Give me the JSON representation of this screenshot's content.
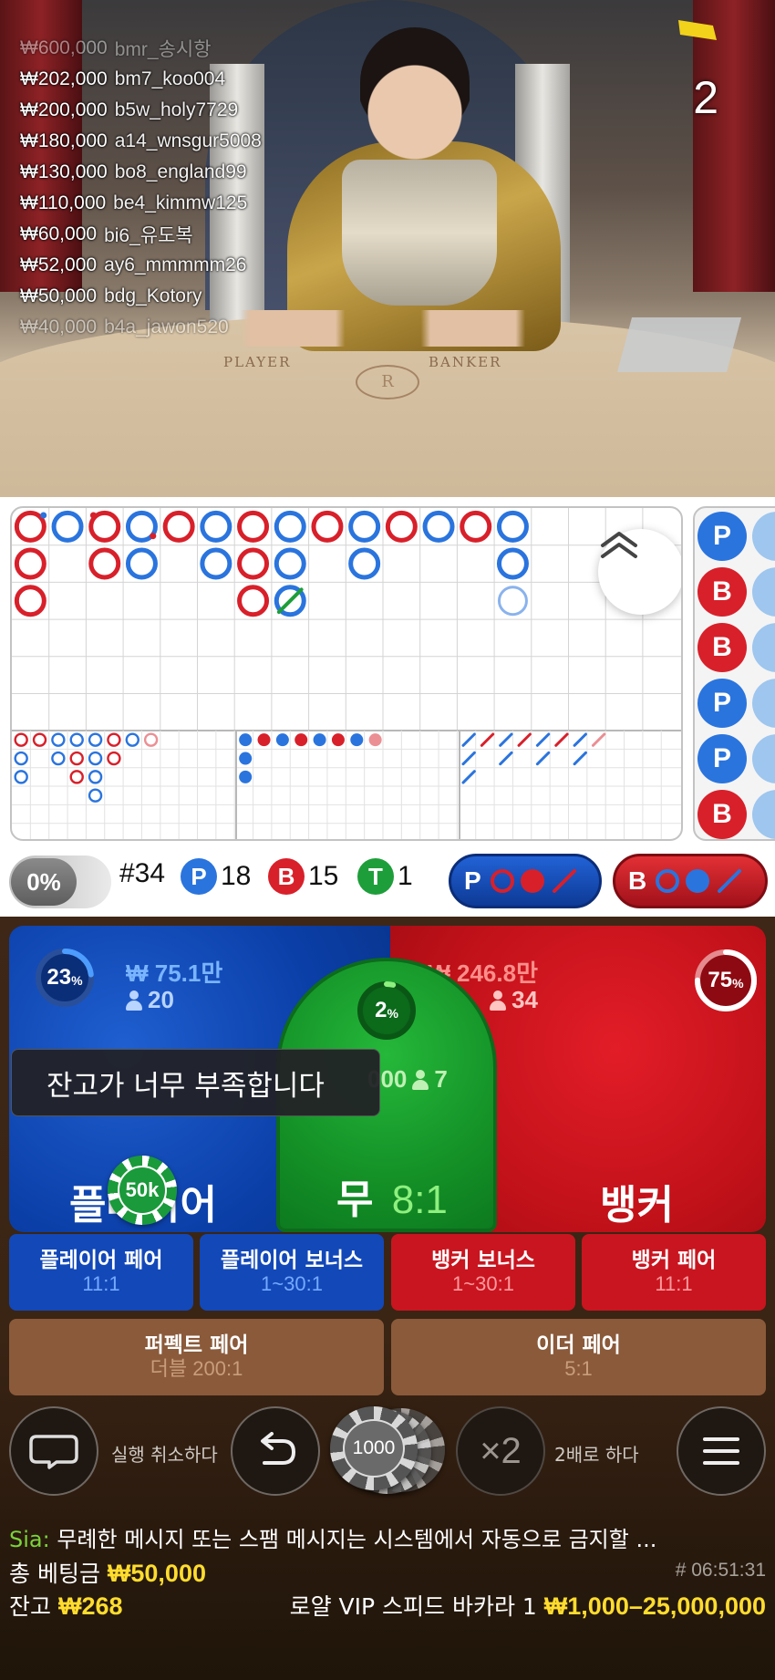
{
  "video": {
    "round_count": "2",
    "felt_player": "PLAYER",
    "felt_banker": "BANKER",
    "felt_logo": "R",
    "winners": [
      {
        "amount": "₩600,000",
        "user": "bmr_송시항",
        "faded": true
      },
      {
        "amount": "₩202,000",
        "user": "bm7_koo004"
      },
      {
        "amount": "₩200,000",
        "user": "b5w_holy7729"
      },
      {
        "amount": "₩180,000",
        "user": "a14_wnsgur5008"
      },
      {
        "amount": "₩130,000",
        "user": "bo8_england99"
      },
      {
        "amount": "₩110,000",
        "user": "be4_kimmw125"
      },
      {
        "amount": "₩60,000",
        "user": "bi6_유도복"
      },
      {
        "amount": "₩52,000",
        "user": "ay6_mmmmm26"
      },
      {
        "amount": "₩50,000",
        "user": "bdg_Kotory"
      },
      {
        "amount": "₩40,000",
        "user": "b4a_jawon520",
        "faded": true
      }
    ]
  },
  "roadmap": {
    "colors": {
      "player": "#2a74de",
      "banker": "#d8202a",
      "tie": "#1e9e3a",
      "grid": "#d4d4d4"
    },
    "side_road": [
      "P",
      "B",
      "B",
      "P",
      "P",
      "B"
    ]
  },
  "stats": {
    "percent_toggle": "0%",
    "round_number": "#34",
    "player_letter": "P",
    "player_count": "18",
    "banker_letter": "B",
    "banker_count": "15",
    "tie_letter": "T",
    "tie_count": "1",
    "predict_player_letter": "P",
    "predict_banker_letter": "B"
  },
  "betting": {
    "player": {
      "percent": "23",
      "percent_fraction": 0.23,
      "amount": "₩ 75.1만",
      "count": "20",
      "title": "플레이어"
    },
    "banker": {
      "percent": "75",
      "percent_fraction": 0.75,
      "amount": "₩ 246.8만",
      "count": "34",
      "title": "뱅커"
    },
    "tie": {
      "percent": "2",
      "percent_fraction": 0.02,
      "amount_partial": "000",
      "count": "7",
      "title": "무",
      "odds": "8:1"
    },
    "toast": "잔고가 너무 부족합니다",
    "placed_chip": "50k",
    "side_bets": [
      {
        "label": "플레이어 페어",
        "odds": "11:1"
      },
      {
        "label": "플레이어 보너스",
        "odds": "1~30:1"
      },
      {
        "label": "뱅커 보너스",
        "odds": "1~30:1"
      },
      {
        "label": "뱅커 페어",
        "odds": "11:1"
      },
      {
        "label": "퍼펙트 페어",
        "odds": "더블 200:1"
      },
      {
        "label": "이더 페어",
        "odds": "5:1"
      }
    ]
  },
  "controls": {
    "undo_label": "실행 취소하다",
    "selected_chip": "1000",
    "double_symbol": "×2",
    "double_label": "2배로 하다"
  },
  "footer": {
    "chat_user": "Sia:",
    "chat_text": " 무례한 메시지 또는 스팸 메시지는 시스템에서 자동으로 금지할 ...",
    "total_bet_label": "총 베팅금",
    "total_bet": "₩50,000",
    "game_id": "# 06:51:31",
    "balance_label": "잔고",
    "balance": "₩268",
    "table_name": "로얄 VIP 스피드 바카라 1",
    "limits": "₩1,000–25,000,000"
  }
}
